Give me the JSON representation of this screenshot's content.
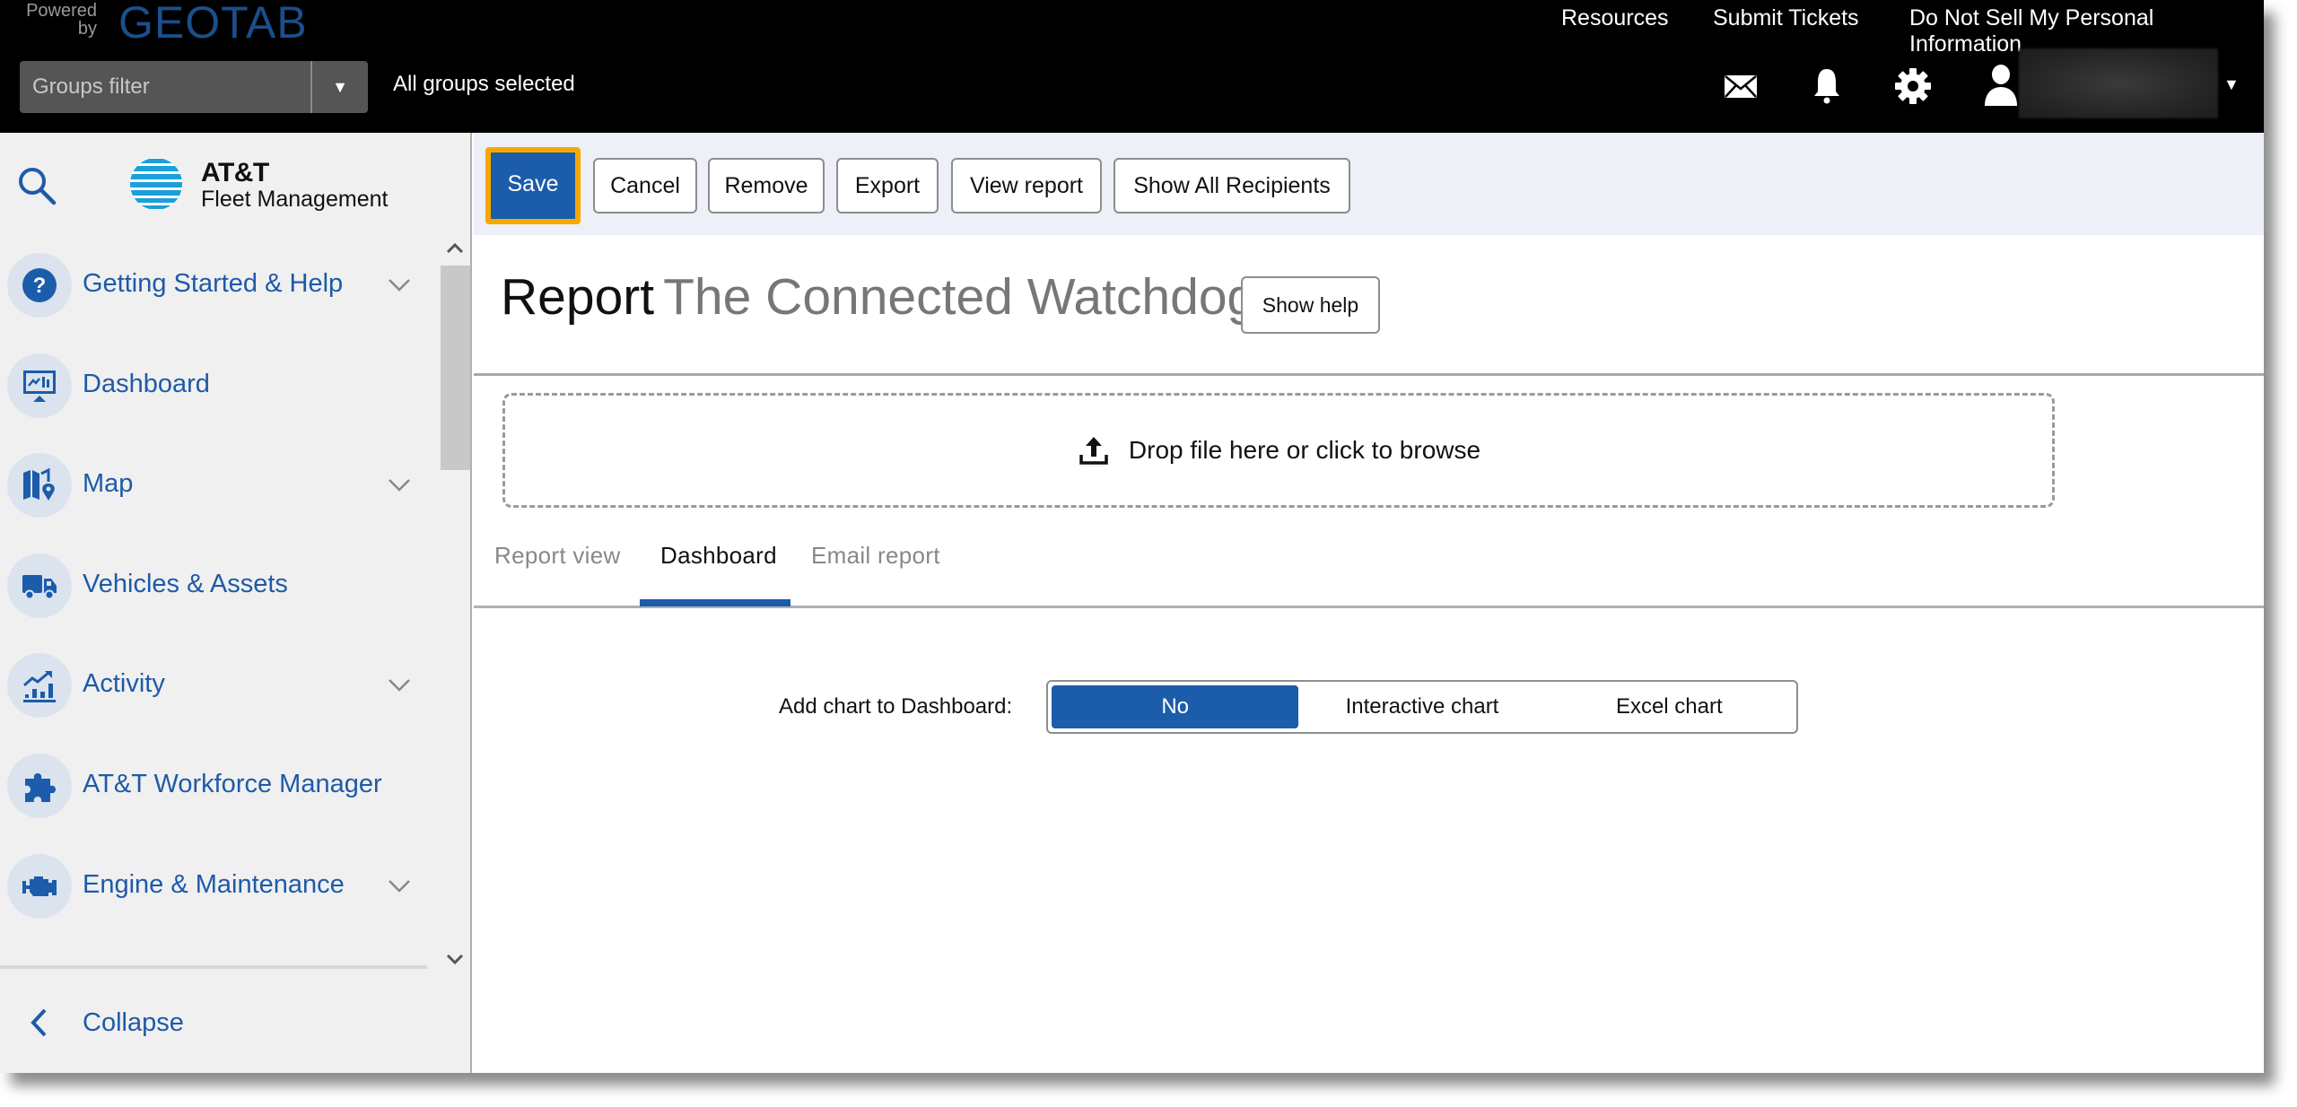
{
  "header": {
    "powered_by": "Powered by",
    "brand": "GEOTAB",
    "links": [
      "Resources",
      "Submit Tickets",
      "Do Not Sell My Personal Information"
    ],
    "groups_filter": {
      "placeholder": "Groups filter",
      "status": "All groups selected"
    },
    "icons": [
      "mail-icon",
      "bell-icon",
      "gear-icon",
      "user-icon"
    ]
  },
  "sidebar": {
    "logo": {
      "name": "AT&T",
      "subtitle": "Fleet Management"
    },
    "items": [
      {
        "label": "Getting Started & Help",
        "icon": "help-icon",
        "expandable": true
      },
      {
        "label": "Dashboard",
        "icon": "dashboard-icon",
        "expandable": false
      },
      {
        "label": "Map",
        "icon": "map-icon",
        "expandable": true
      },
      {
        "label": "Vehicles & Assets",
        "icon": "truck-icon",
        "expandable": false
      },
      {
        "label": "Activity",
        "icon": "activity-chart-icon",
        "expandable": true
      },
      {
        "label": "AT&T Workforce Manager",
        "icon": "puzzle-icon",
        "expandable": false
      },
      {
        "label": "Engine & Maintenance",
        "icon": "engine-icon",
        "expandable": true
      }
    ],
    "collapse_label": "Collapse"
  },
  "toolbar": {
    "buttons": [
      "Save",
      "Cancel",
      "Remove",
      "Export",
      "View report",
      "Show All Recipients"
    ]
  },
  "report": {
    "title_prefix": "Report",
    "title_name": "The Connected Watchdog",
    "show_help": "Show help",
    "dropzone_label": "Drop file here or click to browse"
  },
  "tabs": [
    {
      "label": "Report view",
      "active": false
    },
    {
      "label": "Dashboard",
      "active": true
    },
    {
      "label": "Email report",
      "active": false
    }
  ],
  "dashboard": {
    "add_chart_label": "Add chart to Dashboard:",
    "options": [
      "No",
      "Interactive chart",
      "Excel chart"
    ],
    "selected": "No"
  },
  "colors": {
    "accent": "#1b5cab",
    "highlight": "#f7a800",
    "nav_text": "#1e5aa8",
    "header_bg": "#000000"
  }
}
